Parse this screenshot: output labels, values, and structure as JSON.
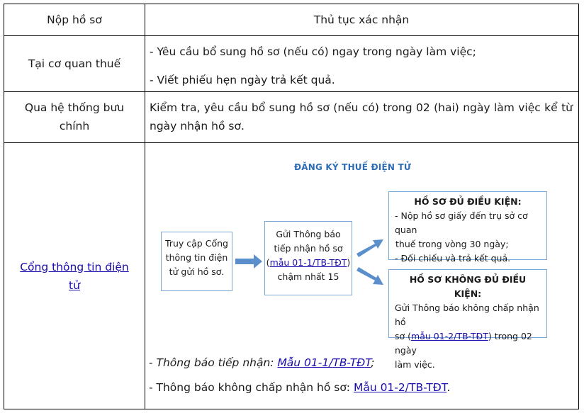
{
  "header": {
    "col1": "Nộp hồ sơ",
    "col2": "Thủ tục xác nhận"
  },
  "rows": [
    {
      "method": "Tại cơ quan thuế",
      "lines": [
        "- Yêu cầu bổ sung hồ sơ (nếu có) ngay trong ngày làm việc;",
        "- Viết phiếu hẹn ngày trả kết quả."
      ]
    },
    {
      "method_line1": "Qua hệ thống bưu",
      "method_line2": "chính",
      "text": "Kiểm tra, yêu cầu bổ sung hồ sơ (nếu có) trong 02 (hai) ngày làm việc kể từ ngày nhận hồ sơ."
    },
    {
      "method_link": "Cổng thông tin điện tử",
      "note1_prefix": "- Thông báo tiếp nhận: ",
      "note1_link": "Mẫu 01-1/TB-TĐT",
      "note1_suffix": ";",
      "note2_prefix": "- Thông báo không chấp nhận hồ sơ: ",
      "note2_link": "Mẫu 01-2/TB-TĐT",
      "note2_suffix": "."
    }
  ],
  "diagram": {
    "title": "ĐĂNG KÝ THUẾ ĐIỆN TỬ",
    "step1": [
      "Truy cập Cổng",
      "thông tin điện",
      "tử gửi hồ sơ."
    ],
    "step2_lines": [
      "Gửi Thông báo",
      "tiếp nhận hồ sơ"
    ],
    "step2_link": "mẫu 01-1/TB-TĐT",
    "step2_last": "chậm nhất 15",
    "ok_title": "HỒ SƠ ĐỦ ĐIỀU KIỆN:",
    "ok_lines": [
      "- Nộp hồ sơ giấy đến trụ sở cơ quan",
      "thuế trong vòng 30 ngày;",
      "- Đối chiếu và trả kết quả."
    ],
    "bad_title": "HỒ SƠ KHÔNG ĐỦ ĐIỀU KIỆN:",
    "bad_line1": "Gửi Thông báo không chấp nhận hồ",
    "bad_line2_prefix": "sơ (",
    "bad_link": "mẫu 01-2/TB-TĐT",
    "bad_line2_suffix": ") trong 02 ngày",
    "bad_line3": "làm việc."
  }
}
